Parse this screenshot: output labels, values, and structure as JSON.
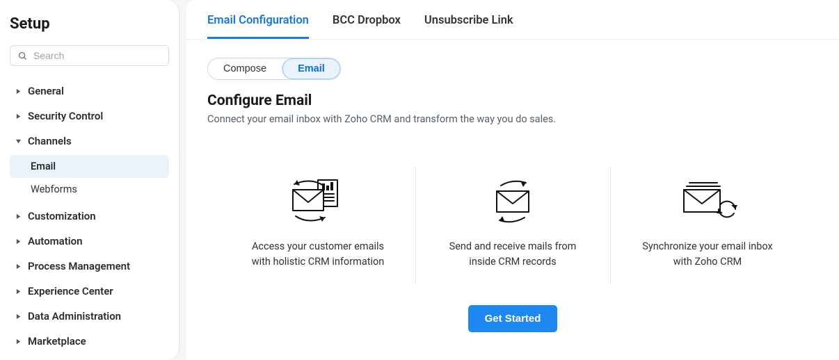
{
  "sidebar": {
    "title": "Setup",
    "search_placeholder": "Search",
    "items": [
      {
        "label": "General",
        "expanded": false
      },
      {
        "label": "Security Control",
        "expanded": false
      },
      {
        "label": "Channels",
        "expanded": true,
        "children": [
          {
            "label": "Email",
            "active": true
          },
          {
            "label": "Webforms",
            "active": false
          }
        ]
      },
      {
        "label": "Customization",
        "expanded": false
      },
      {
        "label": "Automation",
        "expanded": false
      },
      {
        "label": "Process Management",
        "expanded": false
      },
      {
        "label": "Experience Center",
        "expanded": false
      },
      {
        "label": "Data Administration",
        "expanded": false
      },
      {
        "label": "Marketplace",
        "expanded": false
      }
    ]
  },
  "tabs": [
    {
      "label": "Email Configuration",
      "active": true
    },
    {
      "label": "BCC Dropbox",
      "active": false
    },
    {
      "label": "Unsubscribe Link",
      "active": false
    }
  ],
  "toggle": {
    "compose": "Compose",
    "email": "Email",
    "active": "email"
  },
  "section": {
    "title": "Configure Email",
    "desc": "Connect your email inbox with Zoho CRM and transform the way you do sales."
  },
  "features": [
    {
      "text": "Access your customer emails with holistic CRM information",
      "icon": "envelope-doc-cycle-icon"
    },
    {
      "text": "Send and receive mails from inside CRM records",
      "icon": "envelope-arrows-icon"
    },
    {
      "text": "Synchronize your email inbox with Zoho CRM",
      "icon": "envelope-sync-icon"
    }
  ],
  "cta": {
    "label": "Get Started"
  }
}
